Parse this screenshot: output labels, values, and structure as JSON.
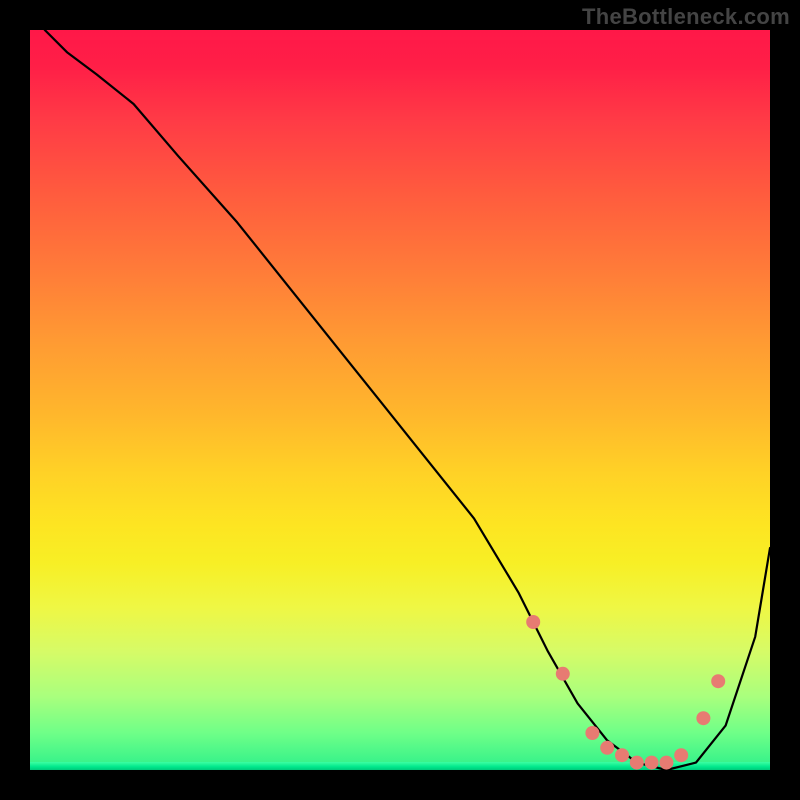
{
  "watermark": "TheBottleneck.com",
  "chart_data": {
    "type": "line",
    "title": "",
    "xlabel": "",
    "ylabel": "",
    "xlim": [
      0,
      100
    ],
    "ylim": [
      0,
      100
    ],
    "series": [
      {
        "name": "curve",
        "color": "#000000",
        "x": [
          2,
          5,
          9,
          14,
          20,
          28,
          36,
          44,
          52,
          60,
          66,
          70,
          74,
          78,
          82,
          86,
          90,
          94,
          98,
          100
        ],
        "y": [
          100,
          97,
          94,
          90,
          83,
          74,
          64,
          54,
          44,
          34,
          24,
          16,
          9,
          4,
          1,
          0,
          1,
          6,
          18,
          30
        ]
      }
    ],
    "markers": {
      "name": "dots",
      "color": "#e77b72",
      "x": [
        68,
        72,
        76,
        78,
        80,
        82,
        84,
        86,
        88,
        91,
        93
      ],
      "y": [
        20,
        13,
        5,
        3,
        2,
        1,
        1,
        1,
        2,
        7,
        12
      ]
    },
    "legend": false,
    "grid": false
  }
}
